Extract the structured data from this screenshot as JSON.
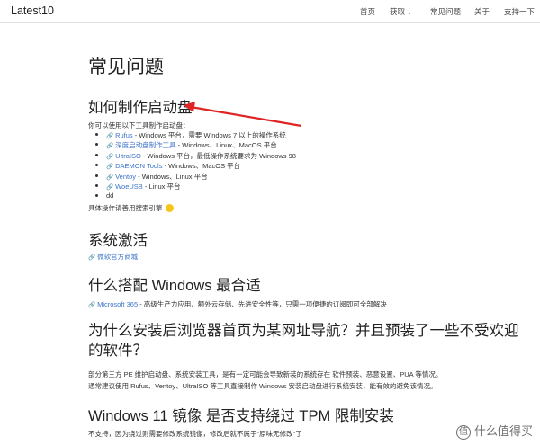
{
  "navbar": {
    "brand": "Latest10",
    "items": [
      {
        "label": "首页"
      },
      {
        "label": "获取"
      },
      {
        "label": "常见问题"
      },
      {
        "label": "关于"
      },
      {
        "label": "支持一下"
      }
    ]
  },
  "page": {
    "title": "常见问题",
    "boot": {
      "heading": "如何制作启动盘",
      "intro": "你可以使用以下工具制作启动盘：",
      "items": [
        {
          "name": "Rufus",
          "desc": " - Windows 平台，需要 Windows 7 以上的操作系统"
        },
        {
          "name": "深度启动盘制作工具",
          "desc": " - Windows、Linux、MacOS 平台"
        },
        {
          "name": "UltraISO",
          "desc": " - Windows 平台，最低操作系统要求为 Windows 98"
        },
        {
          "name": "DAEMON Tools",
          "desc": " - Windows、MacOS 平台"
        },
        {
          "name": "Ventoy",
          "desc": " - Windows、Linux 平台"
        },
        {
          "name": "WoeUSB",
          "desc": " - Linux 平台"
        },
        {
          "name": "",
          "desc": "dd"
        }
      ],
      "howto": "具体操作请善用搜索引擎"
    },
    "activate": {
      "heading": "系统激活",
      "link": "微软官方商城"
    },
    "windows": {
      "heading": "什么搭配 Windows 最合适",
      "link": "Microsoft 365",
      "desc": " - 高级生产力应用、额外云存储、先进安全性等，只需一项便捷的订阅即可全部解决"
    },
    "browser": {
      "heading": "为什么安装后浏览器首页为某网址导航？并且预装了一些不受欢迎的软件？",
      "para1": "部分第三方 PE 维护启动盘、系统安装工具，是有一定可能会导致新装的系统存在 软件预装、恶意设置、PUA 等情况。",
      "para2": "通常建议使用 Rufus、Ventoy、UltraISO 等工具直接制作 Windows 安装启动盘进行系统安装，能有效的避免该情况。"
    },
    "win11": {
      "heading": "Windows 11 镜像 是否支持绕过 TPM 限制安装",
      "para": "不支持，因为绕过则需要修改系统镜像，修改后就不属于\"原味无修改\"了"
    }
  },
  "watermark": {
    "logo": "值",
    "text": "什么值得买"
  },
  "colors": {
    "link": "#3b73c8",
    "arrow": "#e02424"
  },
  "icons": {
    "link": "link-icon",
    "emoji": "smile-emoji-icon"
  }
}
